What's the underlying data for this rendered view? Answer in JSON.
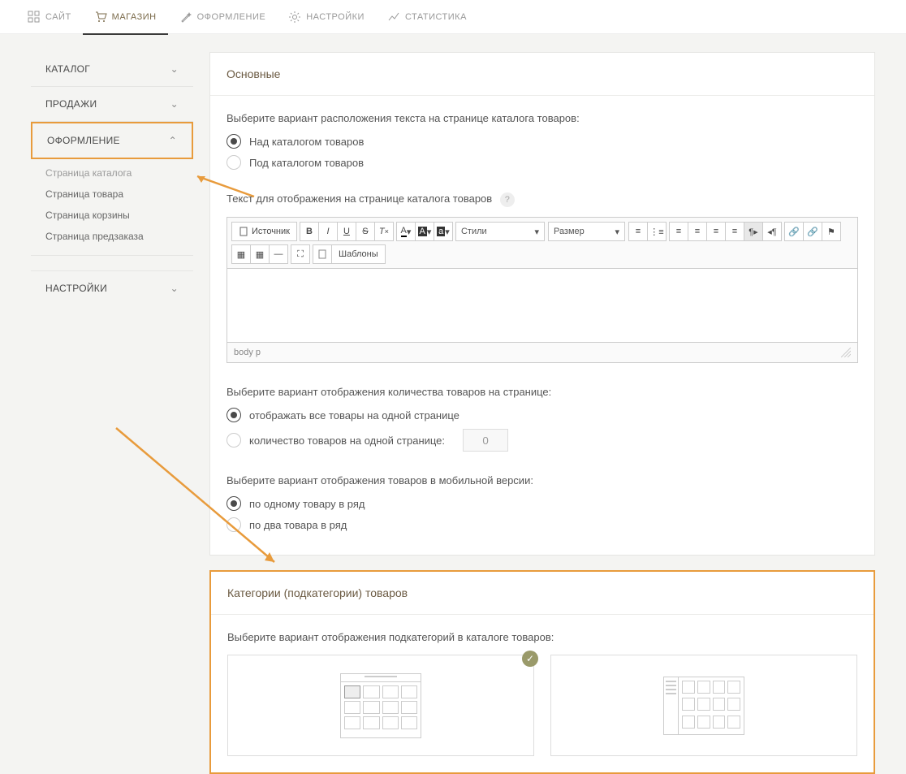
{
  "topnav": {
    "items": [
      {
        "icon": "grid",
        "label": "САЙТ"
      },
      {
        "icon": "cart",
        "label": "МАГАЗИН",
        "active": true
      },
      {
        "icon": "wand",
        "label": "ОФОРМЛЕНИЕ"
      },
      {
        "icon": "gear",
        "label": "НАСТРОЙКИ"
      },
      {
        "icon": "stats",
        "label": "СТАТИСТИКА"
      }
    ]
  },
  "sidebar": {
    "groups": [
      {
        "label": "КАТАЛОГ",
        "open": false
      },
      {
        "label": "ПРОДАЖИ",
        "open": false
      },
      {
        "label": "ОФОРМЛЕНИЕ",
        "open": true,
        "highlighted": true,
        "items": [
          {
            "label": "Страница каталога",
            "active": true
          },
          {
            "label": "Страница товара"
          },
          {
            "label": "Страница корзины"
          },
          {
            "label": "Страница предзаказа"
          }
        ]
      },
      {
        "label": "НАСТРОЙКИ",
        "open": false
      }
    ]
  },
  "panel_main": {
    "title": "Основные",
    "text_position": {
      "label": "Выберите вариант расположения текста на странице каталога товаров:",
      "options": [
        {
          "label": "Над каталогом товаров",
          "checked": true
        },
        {
          "label": "Под каталогом товаров",
          "checked": false
        }
      ]
    },
    "catalog_text": {
      "label": "Текст для отображения на странице каталога товаров",
      "help": "?"
    },
    "editor": {
      "source_label": "Источник",
      "style_select": "Стили",
      "size_select": "Размер",
      "templates_label": "Шаблоны",
      "status": "body p"
    },
    "item_count": {
      "label": "Выберите вариант отображения количества товаров на странице:",
      "options": [
        {
          "label": "отображать все товары на одной странице",
          "checked": true
        },
        {
          "label": "количество товаров на одной странице:",
          "checked": false,
          "value": "0"
        }
      ]
    },
    "mobile": {
      "label": "Выберите вариант отображения товаров в мобильной версии:",
      "options": [
        {
          "label": "по одному товару в ряд",
          "checked": true
        },
        {
          "label": "по два товара в ряд",
          "checked": false
        }
      ]
    }
  },
  "panel_categories": {
    "title": "Категории (подкатегории) товаров",
    "label": "Выберите вариант отображения подкатегорий в каталоге товаров:",
    "selected_badge": "✓"
  }
}
